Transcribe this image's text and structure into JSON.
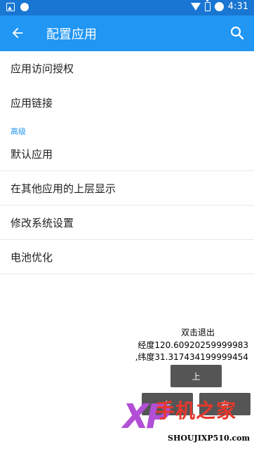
{
  "status_bar": {
    "time": "4:31",
    "left_icons": [
      "image-icon",
      "android-icon"
    ],
    "right_icons": [
      "wifi-icon",
      "battery-icon",
      "alarm-icon"
    ]
  },
  "toolbar": {
    "title": "配置应用",
    "back_icon": "back-arrow-icon",
    "search_icon": "search-icon",
    "color": "#2196f3"
  },
  "list": {
    "items_top": [
      "应用访问授权",
      "应用链接"
    ],
    "section_header": "高级",
    "items_advanced": [
      "默认应用",
      "在其他应用的上层显示",
      "修改系统设置",
      "电池优化"
    ]
  },
  "overlay": {
    "double_click_exit": "双击退出",
    "longitude": "经度120.60920259999983",
    "latitude": ",纬度31.317434199999454",
    "btn_up": "上",
    "btn_left": "左",
    "btn_right": "右"
  },
  "watermark": {
    "logo_text": "XP",
    "site_name": "手机之家",
    "url": "SHOUJIXP510.com"
  }
}
